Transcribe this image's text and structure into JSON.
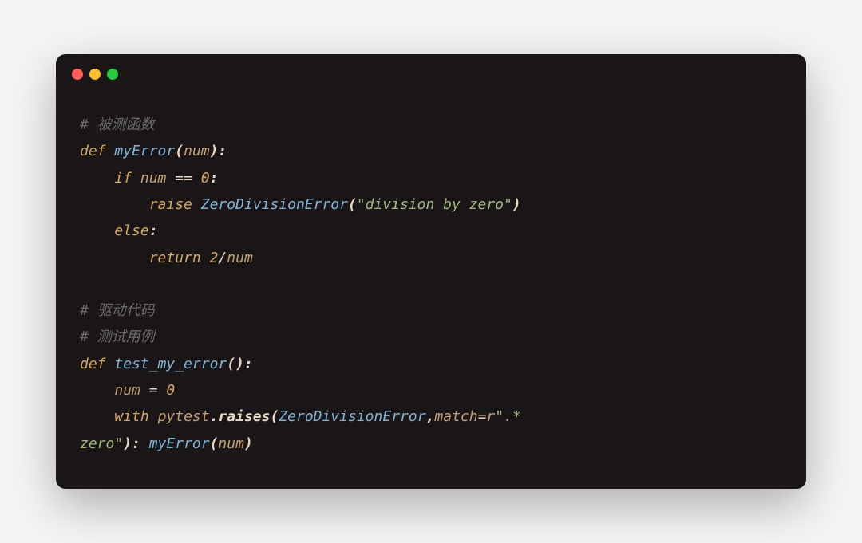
{
  "window": {
    "close": "close",
    "minimize": "minimize",
    "maximize": "maximize"
  },
  "code": {
    "line1": {
      "hash": "#",
      "comment": " 被测函数"
    },
    "line2": {
      "def": "def",
      "name": "myError",
      "lp": "(",
      "param": "num",
      "rp": "):"
    },
    "line3": {
      "indent": "    ",
      "if": "if",
      "var": " num ",
      "eq": "==",
      "sp": " ",
      "zero": "0",
      "colon": ":"
    },
    "line4": {
      "indent": "        ",
      "raise": "raise",
      "sp": " ",
      "exc": "ZeroDivisionError",
      "lp": "(",
      "str": "\"division by zero\"",
      "rp": ")"
    },
    "line5": {
      "indent": "    ",
      "else": "else",
      "colon": ":"
    },
    "line6": {
      "indent": "        ",
      "return": "return",
      "sp": " ",
      "two": "2",
      "slash": "/",
      "var": "num"
    },
    "line7": {
      "hash": "#",
      "comment": " 驱动代码"
    },
    "line8": {
      "hash": "#",
      "comment": " 测试用例"
    },
    "line9": {
      "def": "def",
      "sp": " ",
      "name": "test_my_error",
      "lp": "(",
      "rp": "):"
    },
    "line10": {
      "indent": "    ",
      "var": "num",
      "eq": " = ",
      "zero": "0"
    },
    "line11": {
      "indent": "    ",
      "with": "with",
      "sp": " ",
      "pytest": "pytest",
      "dot": ".",
      "raises": "raises",
      "lp": "(",
      "exc": "ZeroDivisionError",
      "comma": ",",
      "match": "match",
      "eq": "=",
      "r": "r",
      "str": "\".*"
    },
    "line12": {
      "str": "zero\"",
      "rp": "):",
      "sp": " ",
      "fn": "myError",
      "lp": "(",
      "var": "num",
      "rp2": ")"
    }
  }
}
